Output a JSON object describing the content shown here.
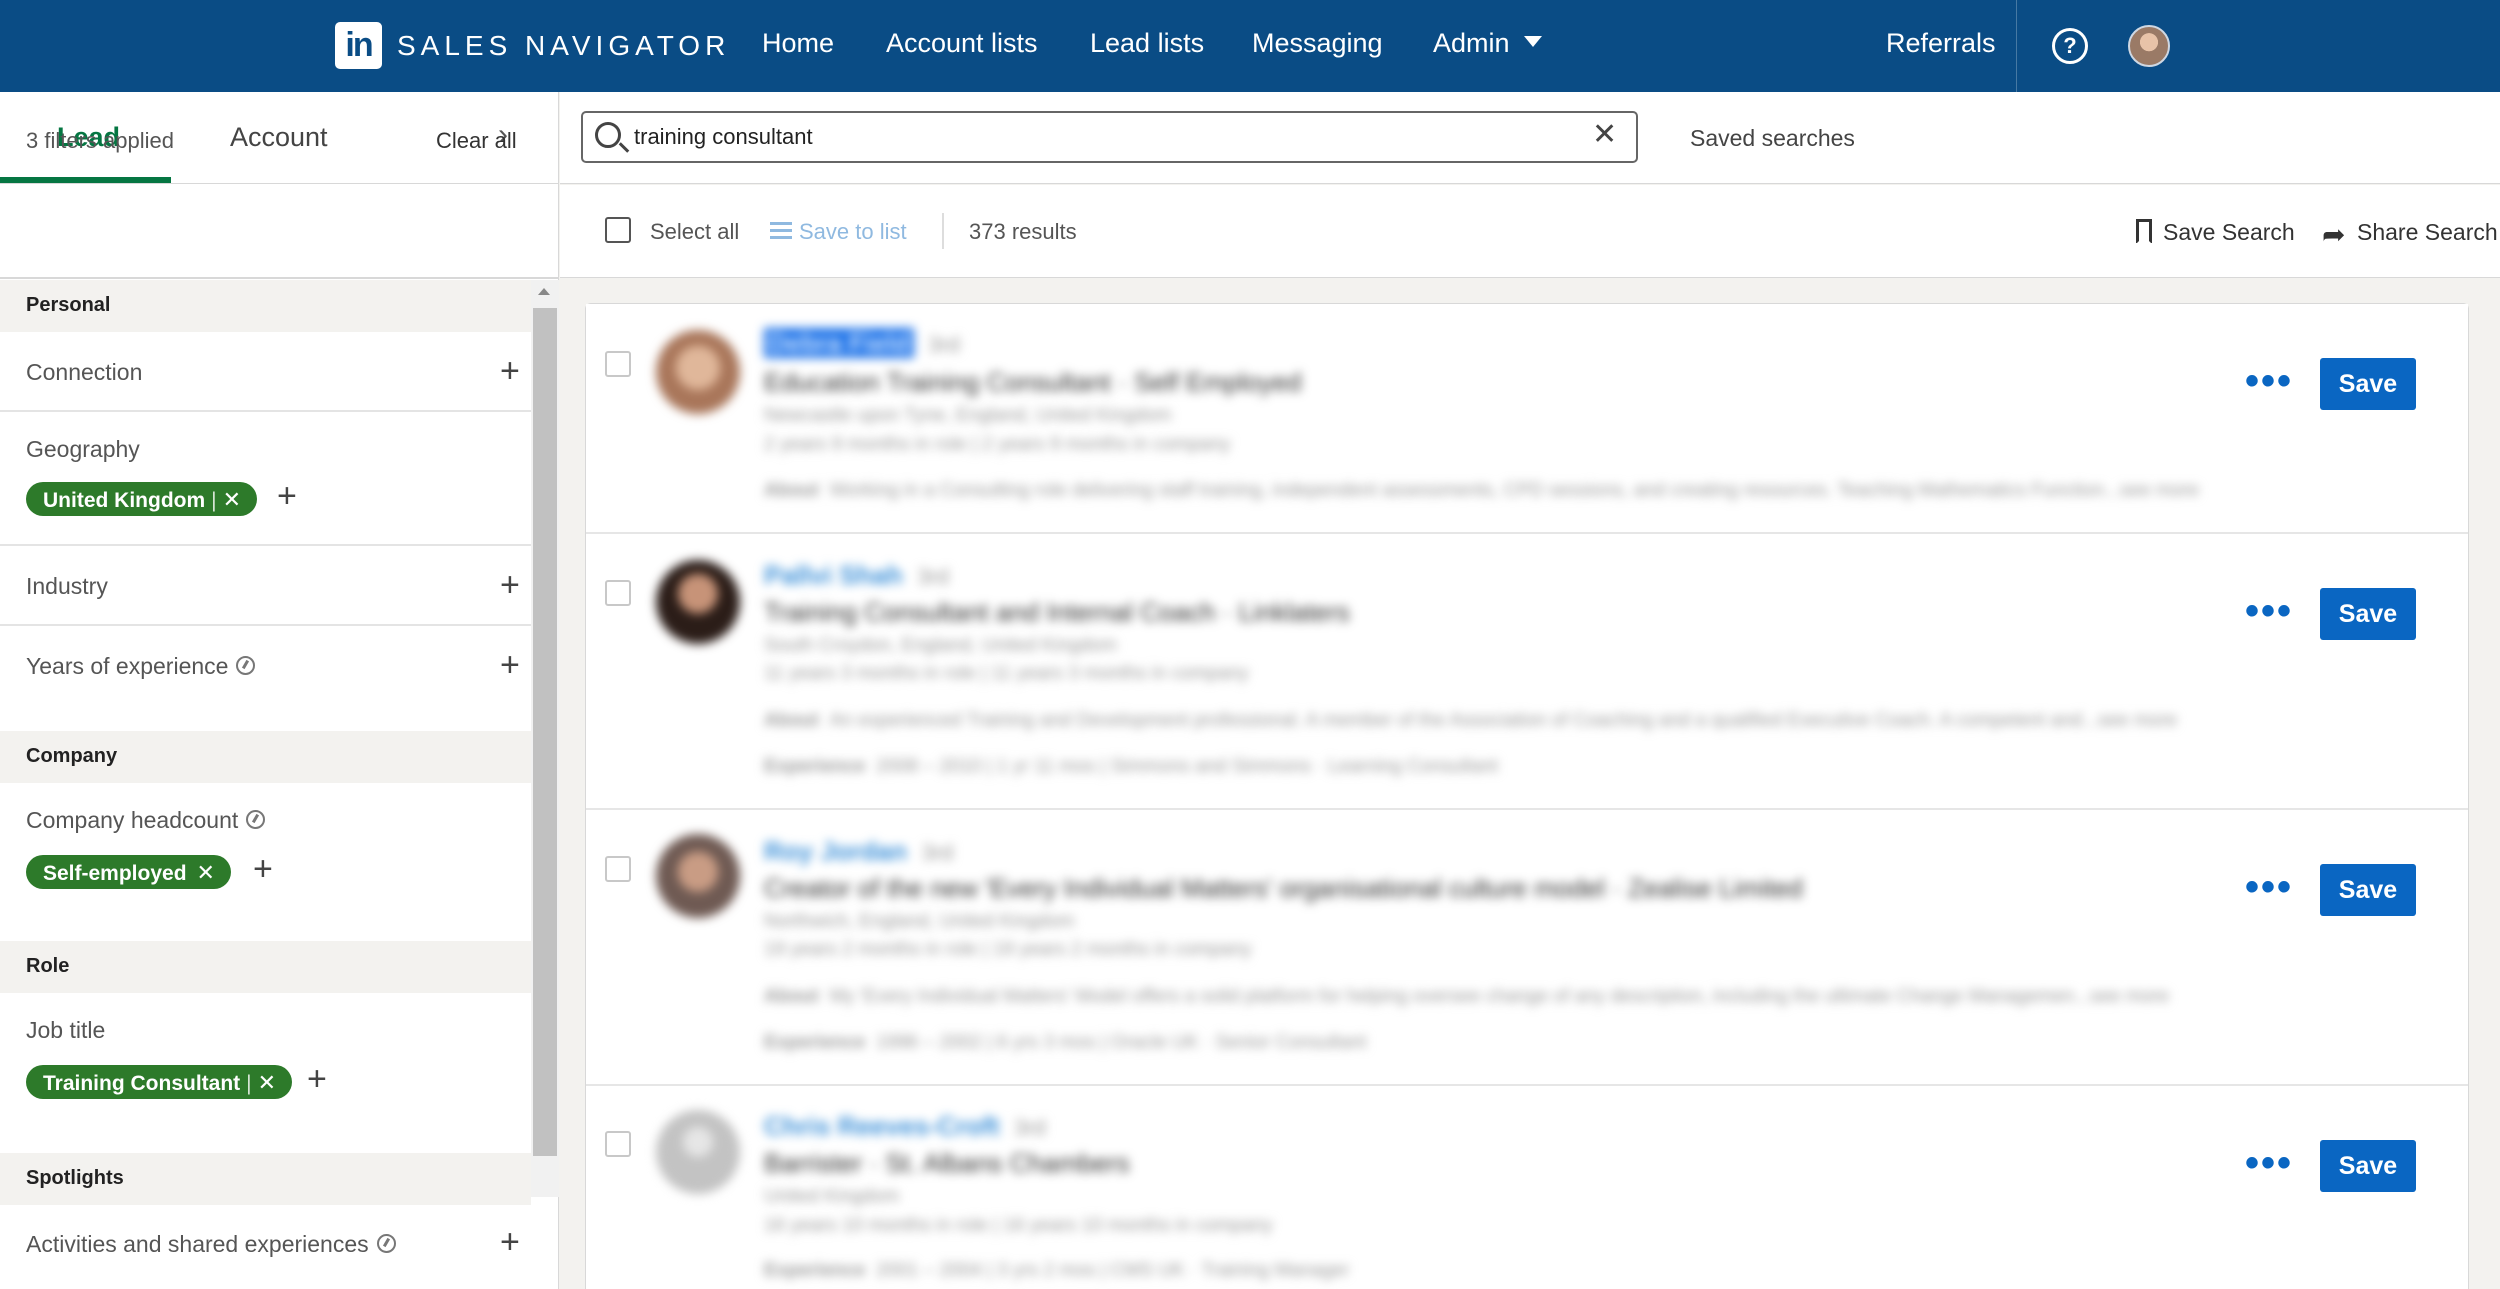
{
  "nav": {
    "logo_mark": "in",
    "logo_text": "SALES NAVIGATOR",
    "items": [
      "Home",
      "Account lists",
      "Lead lists",
      "Messaging",
      "Admin"
    ],
    "referrals": "Referrals",
    "help": "?"
  },
  "left": {
    "tabs": {
      "lead": "Lead",
      "account": "Account",
      "chevron": "›"
    },
    "filters_applied": "3 filters applied",
    "clear_all": "Clear all",
    "sections": {
      "personal": "Personal",
      "company": "Company",
      "role": "Role",
      "spotlights": "Spotlights"
    },
    "filters": {
      "connection": "Connection",
      "geography": "Geography",
      "geography_pill": "United Kingdom",
      "industry": "Industry",
      "years_experience": "Years of experience",
      "company_headcount": "Company headcount",
      "headcount_pill": "Self-employed",
      "job_title": "Job title",
      "job_title_pill": "Training Consultant",
      "activities": "Activities and shared experiences"
    },
    "pill_separator": "|",
    "pill_remove": "✕",
    "add": "+"
  },
  "search": {
    "query": "training consultant",
    "clear": "✕",
    "saved_searches": "Saved searches"
  },
  "toolbar": {
    "select_all": "Select all",
    "save_to_list": "Save to list",
    "results": "373 results",
    "save_search": "Save Search",
    "share_search": "Share Search"
  },
  "leads": [
    {
      "name": "Debra Field",
      "degree": "3rd",
      "title": "Education Training Consultant · Self Employed",
      "location": "Newcastle upon Tyne, England, United Kingdom",
      "tenure": "2 years 9 months in role | 2 years 9 months in company",
      "about_label": "About",
      "about": "Working in a Consulting role delivering staff training, independent assessments, CPD sessions, and creating resources. Teaching Mathematics Function...see more",
      "experience": ""
    },
    {
      "name": "Pallvi Shah",
      "degree": "3rd",
      "title": "Training Consultant and Internal Coach · Linklaters",
      "location": "South Croydon, England, United Kingdom",
      "tenure": "11 years 3 months in role | 11 years 3 months in company",
      "about_label": "About",
      "about": "An experienced Training and Development professional. A member of the Association of Coaching and a qualified Executive Coach. A competent and...see more",
      "experience_label": "Experience",
      "experience": "2008 – 2010 | 1 yr 11 mos | Simmons and Simmons · Learning Consultant"
    },
    {
      "name": "Roy Jordan",
      "degree": "3rd",
      "title": "Creator of the new 'Every Individual Matters' organisational culture model · Zealise Limited",
      "location": "Northwich, England, United Kingdom",
      "tenure": "19 years 2 months in role | 19 years 2 months in company",
      "about_label": "About",
      "about": "My 'Every Individual Matters' Model offers a solid platform for helping oversee change of any description, including the ultimate Change Managemen...see more",
      "experience_label": "Experience",
      "experience": "1996 – 2002 | 6 yrs 3 mos | Oracle UK · Senior Consultant"
    },
    {
      "name": "Chris Reeves-Croft",
      "degree": "3rd",
      "title": "Barrister · St. Albans Chambers",
      "location": "United Kingdom",
      "tenure": "16 years 10 months in role | 16 years 10 months in company",
      "about_label": "",
      "about": "",
      "experience_label": "Experience",
      "experience": "2001 – 2004 | 3 yrs 2 mos | CMS UK · Training Manager"
    }
  ],
  "row_actions": {
    "more": "•••",
    "save": "Save"
  }
}
